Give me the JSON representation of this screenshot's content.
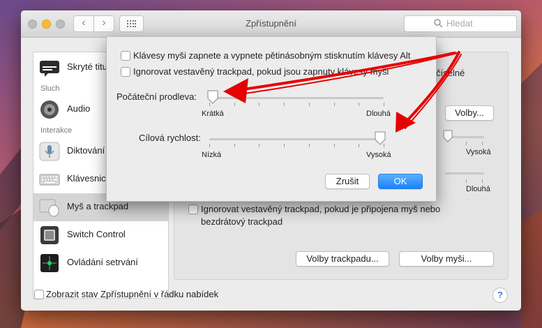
{
  "window": {
    "title": "Zpřístupnění",
    "search_placeholder": "Hledat"
  },
  "sidebar": {
    "items": [
      {
        "label": "Skryté titulky",
        "icon": "captions-icon"
      },
      {
        "section": "Sluch"
      },
      {
        "label": "Audio",
        "icon": "speaker-icon"
      },
      {
        "section": "Interakce"
      },
      {
        "label": "Diktování",
        "icon": "microphone-icon"
      },
      {
        "label": "Klávesnice",
        "icon": "keyboard-icon"
      },
      {
        "label": "Myš a trackpad",
        "icon": "mouse-trackpad-icon",
        "selected": true
      },
      {
        "label": "Switch Control",
        "icon": "switch-control-icon"
      },
      {
        "label": "Ovládání setrvání",
        "icon": "dwell-control-icon"
      }
    ]
  },
  "content": {
    "partial_label_right": "číselné",
    "options_button": "Volby...",
    "slider_bg_1_high_label": "Vysoká",
    "slider_bg_2_high_label": "Dlouhá",
    "ignore_trackpad_checkbox": "Ignorovat vestavěný trackpad, pokud je připojena myš nebo bezdrátový trackpad",
    "ignore_trackpad_checked": false,
    "trackpad_options_button": "Volby trackpadu...",
    "mouse_options_button": "Volby myši..."
  },
  "sheet": {
    "checkbox_mouse_keys": "Klávesy myši zapnete a vypnete pětinásobným stisknutím klávesy Alt",
    "checkbox_mouse_keys_checked": false,
    "checkbox_ignore_trackpad": "Ignorovat vestavěný trackpad, pokud jsou zapnuty klávesy myši",
    "checkbox_ignore_trackpad_checked": false,
    "initial_delay_label": "Počáteční prodleva:",
    "initial_delay_min": "Krátká",
    "initial_delay_max": "Dlouhá",
    "initial_delay_value": 0.02,
    "max_speed_label": "Cílová rychlost:",
    "max_speed_min": "Nízká",
    "max_speed_max": "Vysoká",
    "max_speed_value": 0.98,
    "cancel_button": "Zrušit",
    "ok_button": "OK"
  },
  "footer": {
    "menu_bar_checkbox": "Zobrazit stav Zpřístupnění v řádku nabídek",
    "menu_bar_checked": false,
    "help_button": "?"
  },
  "colors": {
    "accent": "#1a82fb",
    "annotation": "#e60000"
  }
}
